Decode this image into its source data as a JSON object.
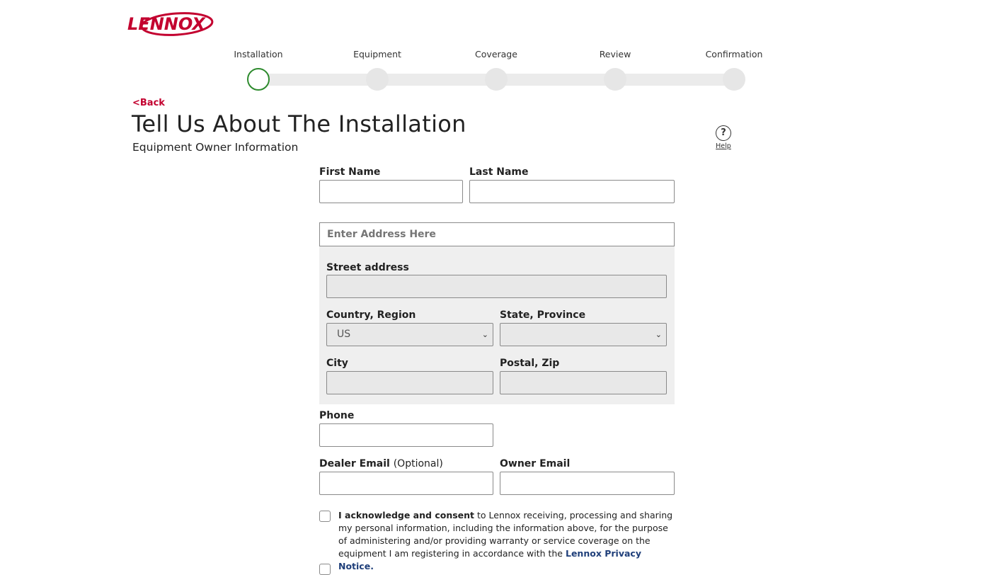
{
  "logo": {
    "text": "LENNOX",
    "color": "#c3002f"
  },
  "stepper": {
    "steps": [
      {
        "label": "Installation",
        "state": "active"
      },
      {
        "label": "Equipment",
        "state": "pending"
      },
      {
        "label": "Coverage",
        "state": "pending"
      },
      {
        "label": "Review",
        "state": "pending"
      },
      {
        "label": "Confirmation",
        "state": "pending"
      }
    ],
    "active_color": "#2e8b2e"
  },
  "header": {
    "back_label": "<Back",
    "title": "Tell Us About The Installation",
    "subtitle": "Equipment Owner Information",
    "help_icon": "question-circle-icon",
    "help_label": "Help"
  },
  "form": {
    "first_name": {
      "label": "First Name",
      "value": ""
    },
    "last_name": {
      "label": "Last Name",
      "value": ""
    },
    "address_search": {
      "placeholder": "Enter Address Here",
      "value": ""
    },
    "street": {
      "label": "Street address",
      "value": ""
    },
    "country": {
      "label": "Country, Region",
      "value": "US"
    },
    "state": {
      "label": "State, Province",
      "value": ""
    },
    "city": {
      "label": "City",
      "value": ""
    },
    "postal": {
      "label": "Postal, Zip",
      "value": ""
    },
    "phone": {
      "label": "Phone",
      "value": ""
    },
    "dealer_email": {
      "label": "Dealer Email",
      "optional": "(Optional)",
      "value": ""
    },
    "owner_email": {
      "label": "Owner Email",
      "value": ""
    }
  },
  "consent": {
    "bold": "I acknowledge and consent",
    "text": " to Lennox receiving, processing and sharing my personal information, including the information above, for the purpose of administering and/or providing warranty or service coverage on the equipment I am registering in accordance with the ",
    "link": "Lennox Privacy Notice.",
    "checked": false
  },
  "colors": {
    "brand": "#c3002f",
    "link": "#1f3f7a",
    "panel": "#efefef"
  }
}
